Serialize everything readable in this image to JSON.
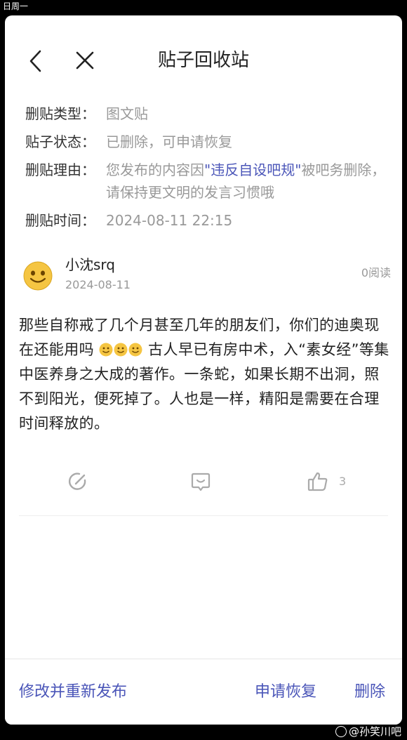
{
  "status_bar": {
    "left_text": "日周一"
  },
  "header": {
    "title": "贴子回收站"
  },
  "info": {
    "rows": [
      {
        "label": "删贴类型：",
        "value": "图文贴"
      },
      {
        "label": "贴子状态：",
        "value": "已删除，可申请恢复"
      },
      {
        "label": "删贴理由：",
        "value_pre": "您发布的内容因",
        "value_link": "\"违反自设吧规\"",
        "value_post": "被吧务删除，请保持更文明的发言习惯哦"
      },
      {
        "label": "删贴时间：",
        "value": "2024-08-11 22:15"
      }
    ]
  },
  "post": {
    "author": "小沈srq",
    "date": "2024-08-11",
    "read_count": "0阅读",
    "content_part1": "那些自称戒了几个月甚至几年的朋友们，你们的迪奥现在还能用吗 ",
    "content_part2": " 古人早已有房中术，入“素女经”等集中医养身之大成的著作。一条蛇，如果长期不出洞，照不到阳光，便死掉了。人也是一样，精阳是需要在合理时间释放的。",
    "like_count": "3"
  },
  "footer": {
    "republish_label": "修改并重新发布",
    "restore_label": "申请恢复",
    "delete_label": "删除"
  },
  "watermark": {
    "text": "@孙笑川吧"
  },
  "colors": {
    "accent": "#4a55b8",
    "muted": "#999999"
  }
}
